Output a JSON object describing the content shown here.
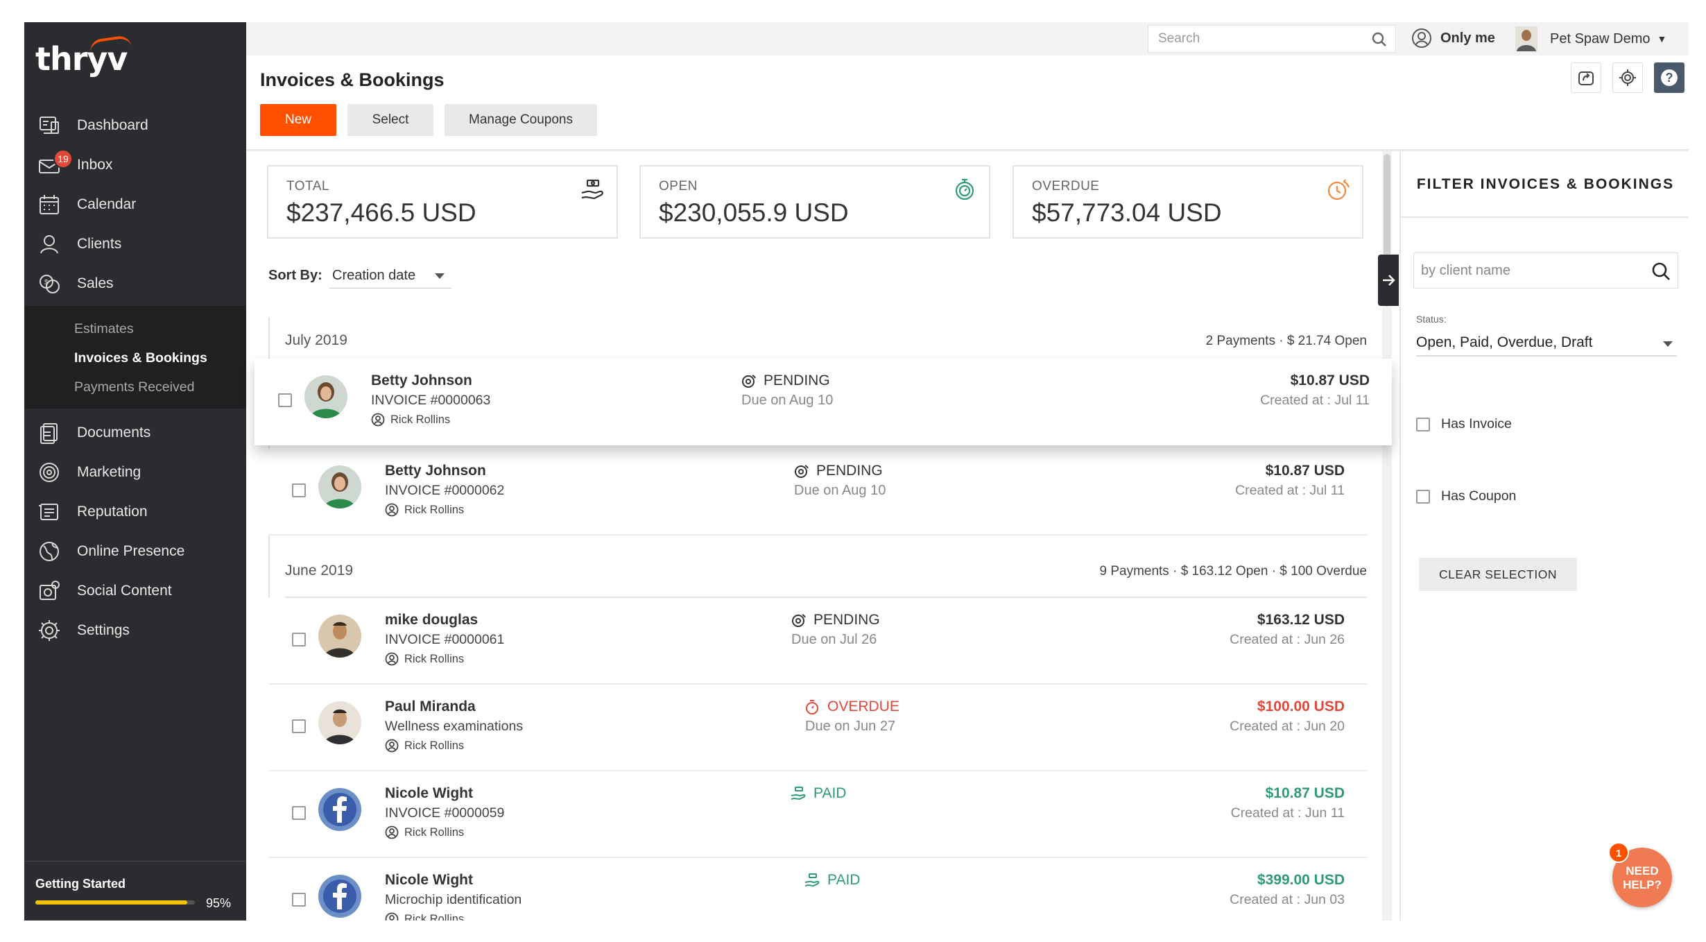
{
  "app": {
    "logo": "thryv"
  },
  "sidebar": {
    "items": [
      {
        "label": "Dashboard",
        "icon": "dashboard-icon"
      },
      {
        "label": "Inbox",
        "icon": "inbox-icon",
        "badge": "19"
      },
      {
        "label": "Calendar",
        "icon": "calendar-icon"
      },
      {
        "label": "Clients",
        "icon": "clients-icon"
      },
      {
        "label": "Sales",
        "icon": "sales-icon"
      }
    ],
    "sub_items": [
      {
        "label": "Estimates"
      },
      {
        "label": "Invoices & Bookings"
      },
      {
        "label": "Payments Received"
      }
    ],
    "items_after": [
      {
        "label": "Documents",
        "icon": "documents-icon"
      },
      {
        "label": "Marketing",
        "icon": "marketing-icon"
      },
      {
        "label": "Reputation",
        "icon": "reputation-icon"
      },
      {
        "label": "Online Presence",
        "icon": "globe-icon"
      },
      {
        "label": "Social Content",
        "icon": "social-content-icon"
      },
      {
        "label": "Settings",
        "icon": "gear-icon"
      }
    ],
    "getting_started": {
      "label": "Getting Started",
      "percent_label": "95%",
      "progress": 0.95
    }
  },
  "topbar": {
    "search_placeholder": "Search",
    "only_me": "Only me",
    "account": "Pet Spaw Demo"
  },
  "header": {
    "title": "Invoices & Bookings",
    "new_label": "New",
    "select_label": "Select",
    "coupons_label": "Manage Coupons"
  },
  "summary": {
    "total": {
      "label": "TOTAL",
      "value": "$237,466.5 USD"
    },
    "open": {
      "label": "OPEN",
      "value": "$230,055.9 USD"
    },
    "overdue": {
      "label": "OVERDUE",
      "value": "$57,773.04 USD"
    }
  },
  "sort": {
    "label": "Sort By:",
    "value": "Creation date"
  },
  "groups": [
    {
      "month": "July 2019",
      "summary": "2 Payments  ·  $ 21.74 Open"
    },
    {
      "month": "June 2019",
      "summary": "9 Payments  ·  $ 163.12 Open  ·  $ 100 Overdue"
    }
  ],
  "rows": [
    {
      "name": "Betty Johnson",
      "sub": "INVOICE #0000063",
      "owner": "Rick Rollins",
      "status": "PENDING",
      "due": "Due on Aug 10",
      "amount": "$10.87 USD",
      "created": "Created at : Jul 11"
    },
    {
      "name": "Betty Johnson",
      "sub": "INVOICE #0000062",
      "owner": "Rick Rollins",
      "status": "PENDING",
      "due": "Due on Aug 10",
      "amount": "$10.87 USD",
      "created": "Created at : Jul 11"
    },
    {
      "name": "mike douglas",
      "sub": "INVOICE #0000061",
      "owner": "Rick Rollins",
      "status": "PENDING",
      "due": "Due on Jul 26",
      "amount": "$163.12 USD",
      "created": "Created at : Jun 26"
    },
    {
      "name": "Paul Miranda",
      "sub": "Wellness examinations",
      "owner": "Rick Rollins",
      "status": "OVERDUE",
      "due": "Due on Jun 27",
      "amount": "$100.00 USD",
      "created": "Created at : Jun 20"
    },
    {
      "name": "Nicole Wight",
      "sub": "INVOICE #0000059",
      "owner": "Rick Rollins",
      "status": "PAID",
      "due": "",
      "amount": "$10.87 USD",
      "created": "Created at : Jun 11"
    },
    {
      "name": "Nicole Wight",
      "sub": "Microchip identification",
      "owner": "Rick Rollins",
      "status": "PAID",
      "due": "",
      "amount": "$399.00 USD",
      "created": "Created at : Jun 03"
    }
  ],
  "filter": {
    "title": "FILTER INVOICES & BOOKINGS",
    "client_placeholder": "by client name",
    "status_label": "Status:",
    "status_value": "Open, Paid, Overdue, Draft",
    "has_invoice": "Has Invoice",
    "has_coupon": "Has Coupon",
    "clear": "CLEAR SELECTION"
  },
  "help": {
    "label_1": "NEED",
    "label_2": "HELP?",
    "badge": "1"
  },
  "colors": {
    "accent": "#ff5000",
    "sidebar": "#2b2c2f",
    "overdue": "#e0493a",
    "paid": "#2e9b74",
    "open": "#2e9b74",
    "overdue_icon": "#f08a3a"
  }
}
